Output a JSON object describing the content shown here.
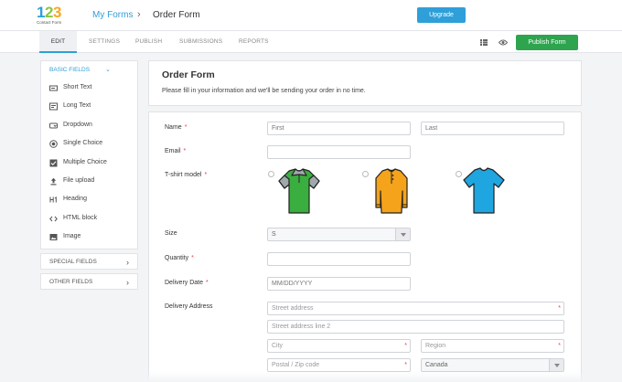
{
  "header": {
    "logo_digits": [
      "1",
      "2",
      "3"
    ],
    "logo_subtitle": "Contact Form",
    "breadcrumb_link": "My Forms",
    "breadcrumb_separator": "›",
    "breadcrumb_current": "Order Form",
    "upgrade_label": "Upgrade"
  },
  "tabs": [
    {
      "label": "EDIT",
      "active": true
    },
    {
      "label": "SETTINGS",
      "active": false
    },
    {
      "label": "PUBLISH",
      "active": false
    },
    {
      "label": "SUBMISSIONS",
      "active": false
    },
    {
      "label": "REPORTS",
      "active": false
    }
  ],
  "toolbar": {
    "publish_label": "Publish Form",
    "icons": [
      "fields-grid-icon",
      "eye-icon"
    ]
  },
  "sidebar": {
    "basic_title": "BASIC FIELDS",
    "basic_items": [
      {
        "label": "Short Text",
        "icon": "short-text-icon"
      },
      {
        "label": "Long Text",
        "icon": "long-text-icon"
      },
      {
        "label": "Dropdown",
        "icon": "dropdown-icon"
      },
      {
        "label": "Single Choice",
        "icon": "radio-icon"
      },
      {
        "label": "Multiple Choice",
        "icon": "checkbox-icon"
      },
      {
        "label": "File upload",
        "icon": "upload-icon"
      },
      {
        "label": "Heading",
        "icon": "heading-icon"
      },
      {
        "label": "HTML block",
        "icon": "code-icon"
      },
      {
        "label": "Image",
        "icon": "image-icon"
      }
    ],
    "special_title": "SPECIAL FIELDS",
    "other_title": "OTHER FIELDS"
  },
  "form": {
    "title": "Order Form",
    "description": "Please fill in your information and we'll be sending your order in no time.",
    "fields": {
      "name": {
        "label": "Name",
        "required_mark": "*",
        "first_placeholder": "First",
        "last_placeholder": "Last"
      },
      "email": {
        "label": "Email",
        "required_mark": "*"
      },
      "tshirt": {
        "label": "T-shirt model",
        "required_mark": "*",
        "colors": [
          "#3aae3e",
          "#f5a31b",
          "#1fa5df"
        ]
      },
      "size": {
        "label": "Size",
        "value": "S"
      },
      "quantity": {
        "label": "Quantity",
        "required_mark": "*"
      },
      "delivery_date": {
        "label": "Delivery Date",
        "required_mark": "*",
        "placeholder": "MM/DD/YYYY"
      },
      "delivery_address": {
        "label": "Delivery Address",
        "street_placeholder": "Street address",
        "street2_placeholder": "Street address line 2",
        "city_placeholder": "City",
        "region_placeholder": "Region",
        "zip_placeholder": "Postal / Zip code",
        "country_value": "Canada",
        "required_mark": "*"
      }
    }
  },
  "colors": {
    "accent": "#2e9fd8",
    "publish_green": "#2ea44f",
    "required_red": "#e0424b"
  }
}
